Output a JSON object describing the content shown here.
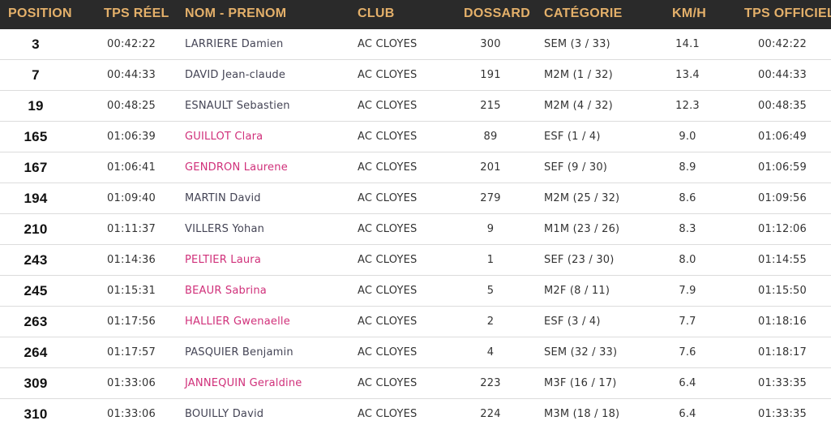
{
  "table": {
    "headers": {
      "position": "POSITION",
      "tps_reel": "TPS RÉEL",
      "nom_prenom": "NOM - PRENOM",
      "club": "CLUB",
      "dossard": "DOSSARD",
      "categorie": "CATÉGORIE",
      "kmh": "KM/H",
      "tps_officiel": "TPS OFFICIEL"
    },
    "colors": {
      "header_bg": "#2a2a2a",
      "header_text": "#e4b06a",
      "female_name": "#d0307a",
      "male_name": "#444455"
    },
    "rows": [
      {
        "position": "3",
        "tps_reel": "00:42:22",
        "nom": "LARRIERE Damien",
        "female": false,
        "club": "AC CLOYES",
        "dossard": "300",
        "categorie": "SEM (3 / 33)",
        "kmh": "14.1",
        "tps_officiel": "00:42:22"
      },
      {
        "position": "7",
        "tps_reel": "00:44:33",
        "nom": "DAVID Jean-claude",
        "female": false,
        "club": "AC CLOYES",
        "dossard": "191",
        "categorie": "M2M (1 / 32)",
        "kmh": "13.4",
        "tps_officiel": "00:44:33"
      },
      {
        "position": "19",
        "tps_reel": "00:48:25",
        "nom": "ESNAULT Sebastien",
        "female": false,
        "club": "AC CLOYES",
        "dossard": "215",
        "categorie": "M2M (4 / 32)",
        "kmh": "12.3",
        "tps_officiel": "00:48:35"
      },
      {
        "position": "165",
        "tps_reel": "01:06:39",
        "nom": "GUILLOT Clara",
        "female": true,
        "club": "AC CLOYES",
        "dossard": "89",
        "categorie": "ESF (1 / 4)",
        "kmh": "9.0",
        "tps_officiel": "01:06:49"
      },
      {
        "position": "167",
        "tps_reel": "01:06:41",
        "nom": "GENDRON Laurene",
        "female": true,
        "club": "AC CLOYES",
        "dossard": "201",
        "categorie": "SEF (9 / 30)",
        "kmh": "8.9",
        "tps_officiel": "01:06:59"
      },
      {
        "position": "194",
        "tps_reel": "01:09:40",
        "nom": "MARTIN David",
        "female": false,
        "club": "AC CLOYES",
        "dossard": "279",
        "categorie": "M2M (25 / 32)",
        "kmh": "8.6",
        "tps_officiel": "01:09:56"
      },
      {
        "position": "210",
        "tps_reel": "01:11:37",
        "nom": "VILLERS Yohan",
        "female": false,
        "club": "AC CLOYES",
        "dossard": "9",
        "categorie": "M1M (23 / 26)",
        "kmh": "8.3",
        "tps_officiel": "01:12:06"
      },
      {
        "position": "243",
        "tps_reel": "01:14:36",
        "nom": "PELTIER Laura",
        "female": true,
        "club": "AC CLOYES",
        "dossard": "1",
        "categorie": "SEF (23 / 30)",
        "kmh": "8.0",
        "tps_officiel": "01:14:55"
      },
      {
        "position": "245",
        "tps_reel": "01:15:31",
        "nom": "BEAUR Sabrina",
        "female": true,
        "club": "AC CLOYES",
        "dossard": "5",
        "categorie": "M2F (8 / 11)",
        "kmh": "7.9",
        "tps_officiel": "01:15:50"
      },
      {
        "position": "263",
        "tps_reel": "01:17:56",
        "nom": "HALLIER Gwenaelle",
        "female": true,
        "club": "AC CLOYES",
        "dossard": "2",
        "categorie": "ESF (3 / 4)",
        "kmh": "7.7",
        "tps_officiel": "01:18:16"
      },
      {
        "position": "264",
        "tps_reel": "01:17:57",
        "nom": "PASQUIER Benjamin",
        "female": false,
        "club": "AC CLOYES",
        "dossard": "4",
        "categorie": "SEM (32 / 33)",
        "kmh": "7.6",
        "tps_officiel": "01:18:17"
      },
      {
        "position": "309",
        "tps_reel": "01:33:06",
        "nom": "JANNEQUIN Geraldine",
        "female": true,
        "club": "AC CLOYES",
        "dossard": "223",
        "categorie": "M3F (16 / 17)",
        "kmh": "6.4",
        "tps_officiel": "01:33:35"
      },
      {
        "position": "310",
        "tps_reel": "01:33:06",
        "nom": "BOUILLY David",
        "female": false,
        "club": "AC CLOYES",
        "dossard": "224",
        "categorie": "M3M (18 / 18)",
        "kmh": "6.4",
        "tps_officiel": "01:33:35"
      }
    ]
  }
}
